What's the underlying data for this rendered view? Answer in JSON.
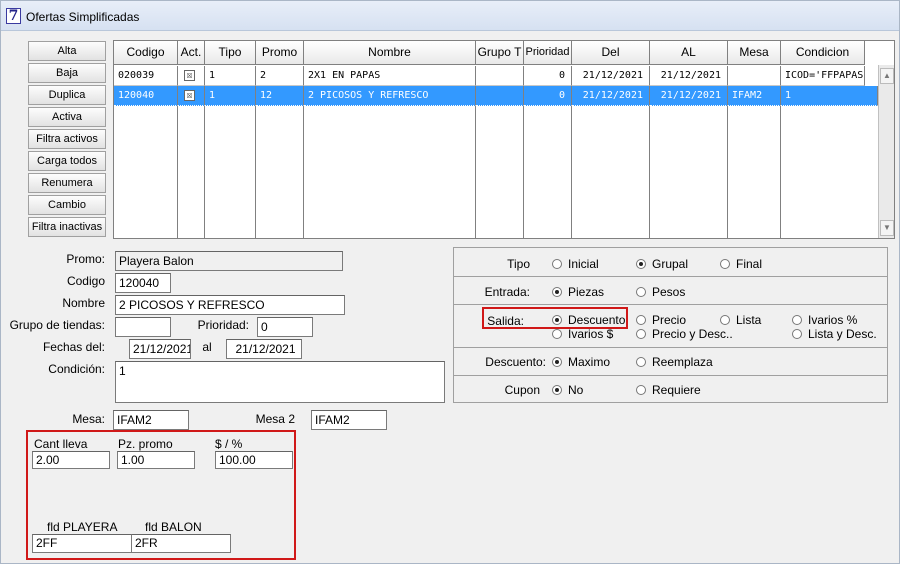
{
  "window": {
    "title": "Ofertas Simplificadas",
    "icon": "app-icon-7",
    "icon_glyph": "7"
  },
  "side_buttons": [
    "Alta",
    "Baja",
    "Duplica",
    "Activa",
    "Filtra activos",
    "Carga todos",
    "Renumera",
    "Cambio",
    "Filtra inactivas"
  ],
  "grid": {
    "columns": [
      "Codigo",
      "Act.",
      "Tipo",
      "Promo",
      "Nombre",
      "Grupo T",
      "Prioridad",
      "Del",
      "AL",
      "Mesa",
      "Condicion"
    ],
    "rows": [
      {
        "codigo": "020039",
        "act": "☒",
        "tipo": "1",
        "promo": "2",
        "nombre": "2X1 EN PAPAS",
        "grupo": "",
        "prioridad": "0",
        "del": "21/12/2021",
        "al": "21/12/2021",
        "mesa": "",
        "condicion": "ICOD='FFPAPAS",
        "selected": false
      },
      {
        "codigo": "120040",
        "act": "☒",
        "tipo": "1",
        "promo": "12",
        "nombre": "2 PICOSOS Y REFRESCO",
        "grupo": "",
        "prioridad": "0",
        "del": "21/12/2021",
        "al": "21/12/2021",
        "mesa": "IFAM2",
        "condicion": "1",
        "selected": true
      }
    ]
  },
  "form": {
    "promo_label": "Promo:",
    "promo_value": "Playera Balon",
    "codigo_label": "Codigo",
    "codigo_value": "120040",
    "nombre_label": "Nombre",
    "nombre_value": "2 PICOSOS Y REFRESCO",
    "grupo_label": "Grupo de tiendas:",
    "grupo_value": "",
    "prioridad_label": "Prioridad:",
    "prioridad_value": "0",
    "fechas_label": "Fechas del:",
    "fecha_del": "21/12/2021",
    "al_label": "al",
    "fecha_al": "21/12/2021",
    "condicion_label": "Condición:",
    "condicion_value": "1",
    "mesa_label": "Mesa:",
    "mesa_value": "IFAM2",
    "mesa2_label": "Mesa 2",
    "mesa2_value": "IFAM2"
  },
  "options": {
    "tipo": {
      "label": "Tipo",
      "items": [
        "Inicial",
        "Grupal",
        "Final"
      ],
      "selected": "Grupal"
    },
    "entrada": {
      "label": "Entrada:",
      "items": [
        "Piezas",
        "Pesos"
      ],
      "selected": "Piezas"
    },
    "salida": {
      "label": "Salida:",
      "items": [
        "Descuento",
        "Precio",
        "Lista",
        "Ivarios %",
        "Ivarios $",
        "Precio y Desc..",
        "Lista y Desc."
      ],
      "selected": "Descuento"
    },
    "descuento": {
      "label": "Descuento:",
      "items": [
        "Maximo",
        "Reemplaza"
      ],
      "selected": "Maximo"
    },
    "cupon": {
      "label": "Cupon",
      "items": [
        "No",
        "Requiere"
      ],
      "selected": "No"
    }
  },
  "params": {
    "cant_label": "Cant lleva",
    "cant_value": "2.00",
    "pz_label": "Pz. promo",
    "pz_value": "1.00",
    "pct_label": "$ / %",
    "pct_value": "100.00",
    "fld1_label": "fld PLAYERA",
    "fld1_value": "2FF",
    "fld2_label": "fld BALON",
    "fld2_value": "2FR"
  },
  "colors": {
    "selection": "#3399ff",
    "highlight_box": "#d01818"
  }
}
